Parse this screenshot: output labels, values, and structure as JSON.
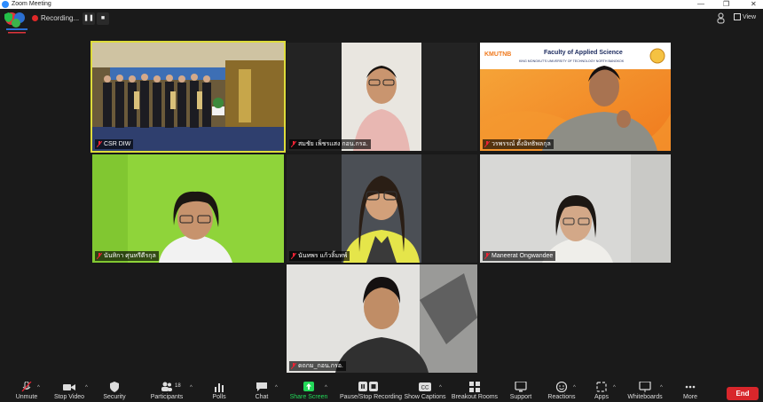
{
  "window": {
    "title": "Zoom Meeting"
  },
  "recording": {
    "label": "Recording..."
  },
  "topbar": {
    "view_label": "View"
  },
  "participants": [
    {
      "name": "CSR DIW",
      "active": true
    },
    {
      "name": "สมชัย เพ็ชรแสง กอน.กรอ.",
      "active": false
    },
    {
      "name": "วรพรรณ์ ตั้งอิทธิพลกุล",
      "active": false
    },
    {
      "name": "นันทิกา ศุนหรีดีรกุล",
      "active": false
    },
    {
      "name": "นันทพร แก้วลิ้มทพ์",
      "active": false
    },
    {
      "name": "Maneerat Ongwandee",
      "active": false
    },
    {
      "name": "ดถกม_กอน.กรอ.",
      "active": false
    }
  ],
  "banner": {
    "logo_text": "KMUTNB",
    "title": "Faculty of Applied Science",
    "subtitle": "KING MONGKUT'S UNIVERSITY OF TECHNOLOGY NORTH BANGKOK"
  },
  "toolbar": {
    "unmute": "Unmute",
    "stop_video": "Stop Video",
    "security": "Security",
    "participants": "Participants",
    "participants_count": "18",
    "polls": "Polls",
    "chat": "Chat",
    "share_screen": "Share Screen",
    "pause_stop_recording": "Pause/Stop Recording",
    "show_captions": "Show Captions",
    "breakout_rooms": "Breakout Rooms",
    "support": "Support",
    "reactions": "Reactions",
    "apps": "Apps",
    "whiteboards": "Whiteboards",
    "more": "More",
    "end": "End"
  },
  "colors": {
    "accent_active_speaker": "#dedc3b",
    "share_screen_green": "#23d959",
    "end_red": "#d8262b",
    "recording_red": "#e02828"
  }
}
